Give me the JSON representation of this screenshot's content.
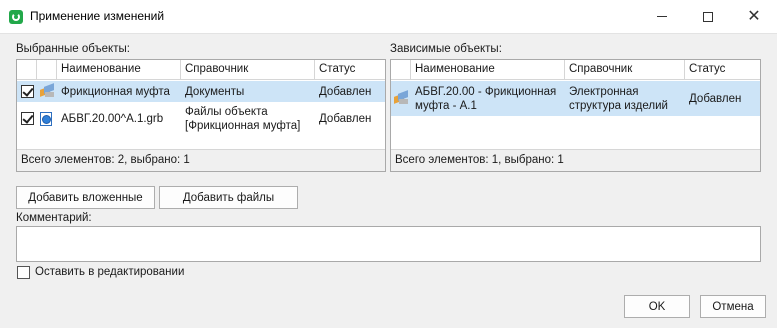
{
  "window": {
    "title": "Применение изменений"
  },
  "selected_objects": {
    "label": "Выбранные объекты:",
    "columns": [
      "Наименование",
      "Справочник",
      "Статус"
    ],
    "rows": [
      {
        "checked": true,
        "icon": "part-icon",
        "name": "Фрикционная муфта",
        "catalog": "Документы",
        "status": "Добавлен",
        "selected": true
      },
      {
        "checked": true,
        "icon": "file-icon",
        "name": "АБВГ.20.00^А.1.grb",
        "catalog": "Файлы объекта [Фрикционная муфта]",
        "status": "Добавлен",
        "selected": false
      }
    ],
    "footer": "Всего элементов: 2, выбрано: 1"
  },
  "dependent_objects": {
    "label": "Зависимые объекты:",
    "columns": [
      "Наименование",
      "Справочник",
      "Статус"
    ],
    "rows": [
      {
        "icon": "part-icon",
        "name": "АБВГ.20.00 - Фрикционная муфта - А.1",
        "catalog": "Электронная структура изделий",
        "status": "Добавлен",
        "selected": true
      }
    ],
    "footer": "Всего элементов: 1, выбрано: 1"
  },
  "buttons": {
    "add_nested": "Добавить вложенные",
    "add_files": "Добавить файлы",
    "ok": "OK",
    "cancel": "Отмена"
  },
  "comment": {
    "label": "Комментарий:",
    "value": ""
  },
  "keep_editing": {
    "label": "Оставить в редактировании",
    "checked": false
  },
  "colors": {
    "selection": "#cde4f7",
    "app_icon": "#22a84a"
  }
}
